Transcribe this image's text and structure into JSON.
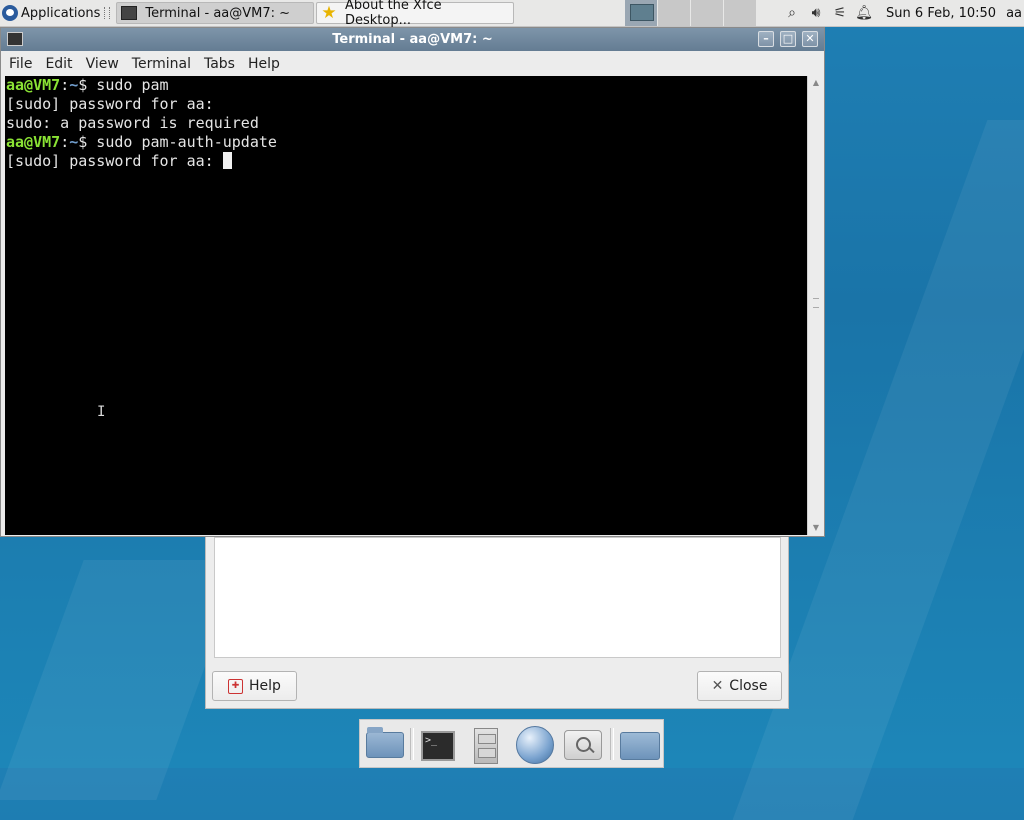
{
  "top_panel": {
    "applications_label": "Applications",
    "tasks": [
      {
        "label": "Terminal - aa@VM7: ~",
        "icon": "terminal-icon",
        "active": true
      },
      {
        "label": "About the Xfce Desktop...",
        "icon": "star-icon",
        "active": false
      }
    ],
    "clock": "Sun  6 Feb, 10:50",
    "user": "aa",
    "tray_icons": [
      "magnifier-icon",
      "volume-icon",
      "network-icon",
      "notification-bell-icon"
    ]
  },
  "terminal": {
    "window_title": "Terminal - aa@VM7: ~",
    "menu": [
      "File",
      "Edit",
      "View",
      "Terminal",
      "Tabs",
      "Help"
    ],
    "lines": [
      {
        "type": "prompt",
        "user": "aa@VM7",
        "sep": ":",
        "path": "~",
        "cmd": "$ sudo pam"
      },
      {
        "type": "out",
        "text": "[sudo] password for aa:"
      },
      {
        "type": "out",
        "text": "sudo: a password is required"
      },
      {
        "type": "prompt",
        "user": "aa@VM7",
        "sep": ":",
        "path": "~",
        "cmd": "$ sudo pam-auth-update"
      },
      {
        "type": "out",
        "text": "[sudo] password for aa: ",
        "cursor": true
      }
    ]
  },
  "about_dialog": {
    "help_label": "Help",
    "close_label": "Close"
  },
  "dock": {
    "items": [
      "home-folder-icon",
      "terminal-icon",
      "file-manager-icon",
      "web-browser-icon",
      "app-finder-icon",
      "folder-icon"
    ]
  },
  "colors": {
    "prompt_user": "#8ae234",
    "prompt_path": "#729fcf",
    "desktop": "#1f7fb4"
  }
}
